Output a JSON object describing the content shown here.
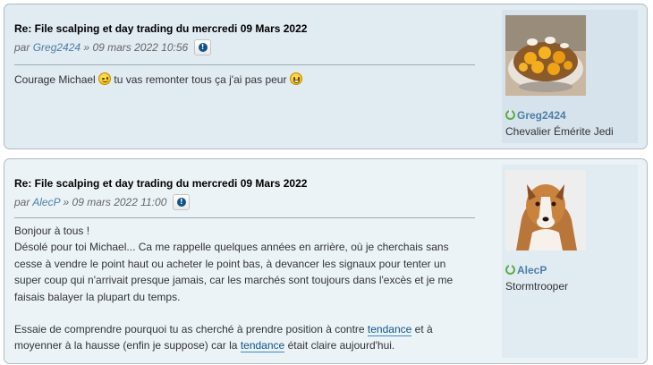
{
  "posts": [
    {
      "title": "Re: File scalping et day trading du mercredi 09 Mars 2022",
      "by_prefix": "par",
      "author": "Greg2424",
      "date_sep": "»",
      "date": "09 mars 2022 10:56",
      "content": {
        "before": "Courage Michael",
        "middle": "tu vas remonter tous ça j'ai pas peur"
      },
      "profile": {
        "username": "Greg2424",
        "rank": "Chevalier Émérite Jedi",
        "avatar_icon": "food-photo-avatar",
        "status_icon": "online-icon"
      }
    },
    {
      "title": "Re: File scalping et day trading du mercredi 09 Mars 2022",
      "by_prefix": "par",
      "author": "AlecP",
      "date_sep": "»",
      "date": "09 mars 2022 11:00",
      "content": {
        "line1": "Bonjour à tous !",
        "para1": "Désolé pour toi Michael... Ca me rappelle quelques années en arrière, où je cherchais sans cesse à vendre le point haut ou acheter le point bas, à devancer les signaux pour tenter un super coup qui n'arrivait presque jamais, car les marchés sont toujours dans l'excès et je me faisais balayer la plupart du temps.",
        "para2_a": "Essaie de comprendre pourquoi tu as cherché à prendre position à contre",
        "para2_link1": "tendance",
        "para2_b": "et à moyenner à la hausse (enfin je suppose) car la",
        "para2_link2": "tendance",
        "para2_c": "était claire aujourd'hui."
      },
      "profile": {
        "username": "AlecP",
        "rank": "Stormtrooper",
        "avatar_icon": "dog-photo-avatar",
        "status_icon": "online-icon"
      }
    }
  ],
  "colors": {
    "post_bg_1": "#e1ebf2",
    "post_bg_2": "#ecf3f7",
    "link": "#105289",
    "username": "#4f7ea6",
    "online": "#5dad46"
  }
}
